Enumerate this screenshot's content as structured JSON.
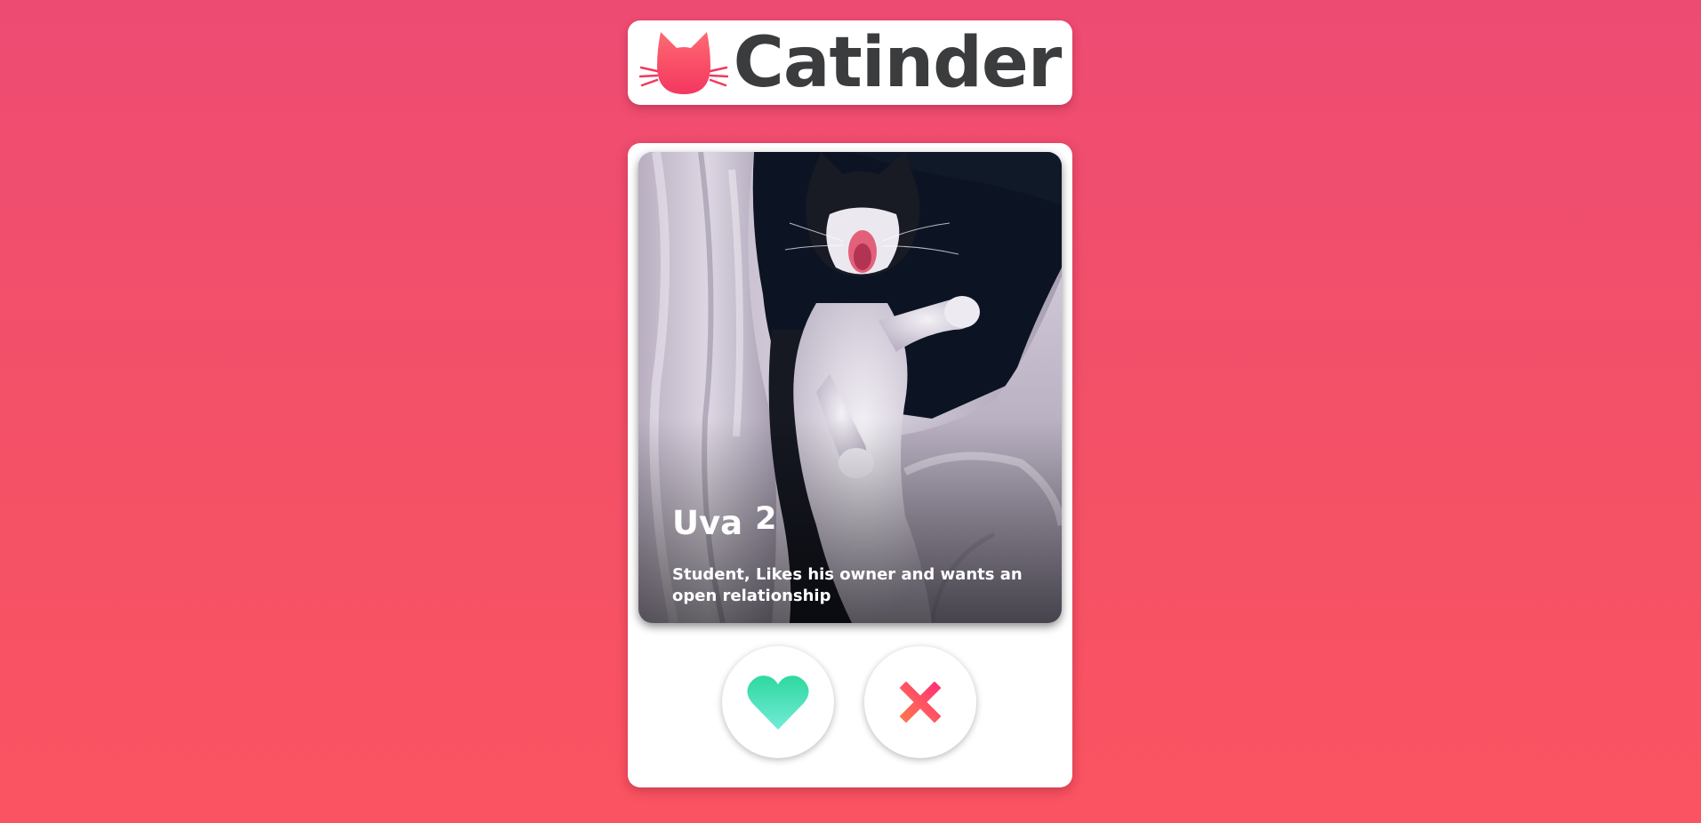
{
  "header": {
    "logo_icon": "cat-head-icon",
    "title": "Catinder"
  },
  "profile": {
    "name": "Uva",
    "age": "2",
    "bio": "Student, Likes his owner and wants an open relationship",
    "photo": "cat-photo"
  },
  "actions": {
    "like_icon": "heart-icon",
    "nope_icon": "x-icon"
  },
  "colors": {
    "background_top": "#ee4b73",
    "background_bottom": "#fb5361",
    "logo_pink_top": "#fd6a72",
    "logo_pink_bottom": "#f5365f",
    "logo_text": "#3b3c3e",
    "like_green_top": "#2ed8a0",
    "like_green_bottom": "#72ecd6",
    "nope_pink_top": "#fe2f78",
    "nope_orange_bottom": "#ff7a4d"
  }
}
